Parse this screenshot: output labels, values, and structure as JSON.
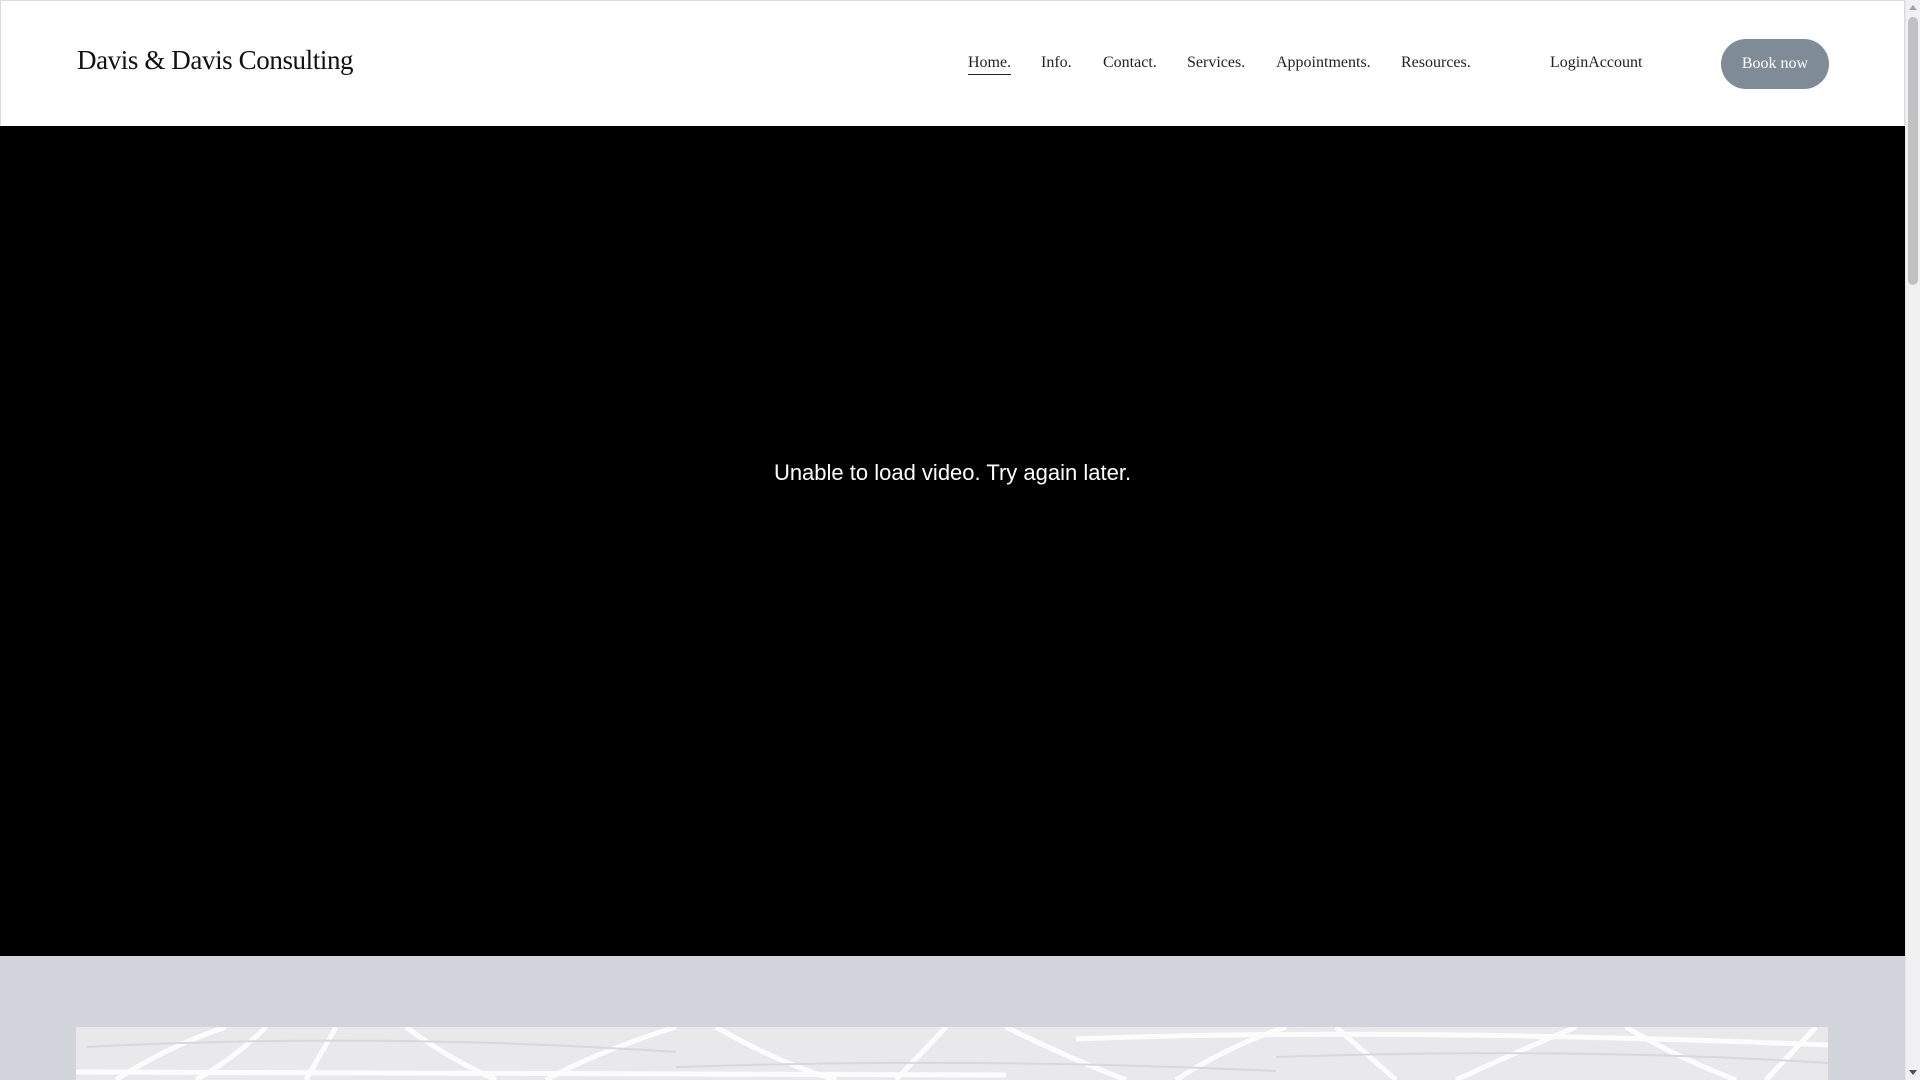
{
  "header": {
    "site_title": "Davis & Davis Consulting",
    "nav": [
      {
        "label": "Home.",
        "active": true
      },
      {
        "label": "Info.",
        "active": false
      },
      {
        "label": "Contact.",
        "active": false
      },
      {
        "label": "Services.",
        "active": false
      },
      {
        "label": "Appointments.",
        "active": false
      },
      {
        "label": "Resources.",
        "active": false
      }
    ],
    "account_label": "LoginAccount",
    "book_button_label": "Book now"
  },
  "hero": {
    "video_error": "Unable to load video. Try again later."
  },
  "colors": {
    "hero_background": "#000000",
    "section_background": "#d2d4dc",
    "button_background": "#7f8b96"
  }
}
